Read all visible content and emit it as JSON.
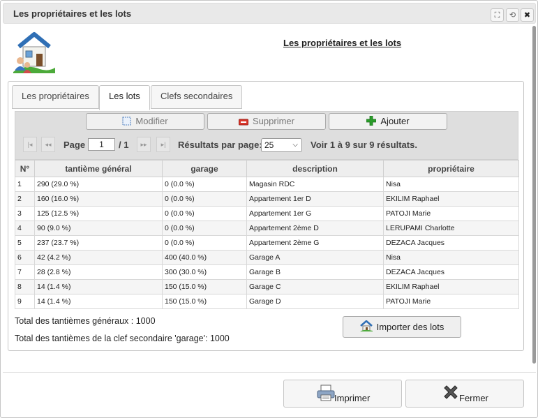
{
  "window": {
    "title": "Les propriétaires et les lots",
    "controls": {
      "maximize": "⛶",
      "restore": "⟲",
      "close": "✖"
    }
  },
  "heading": "Les propriétaires et les lots",
  "tabs": [
    {
      "label": "Les propriétaires",
      "active": false
    },
    {
      "label": "Les lots",
      "active": true
    },
    {
      "label": "Clefs secondaires",
      "active": false
    }
  ],
  "grid_buttons": {
    "modify": "Modifier",
    "delete": "Supprimer",
    "add": "Ajouter"
  },
  "pager": {
    "first": "|◂",
    "prev": "◂◂",
    "page_label": "Page",
    "page_value": "1",
    "page_total": "/ 1",
    "next": "▸▸",
    "last": "▸|",
    "results_label": "Résultats par page:",
    "results_value": "25",
    "summary": "Voir 1 à 9 sur 9 résultats."
  },
  "table": {
    "columns": [
      "N°",
      "tantième général",
      "garage",
      "description",
      "propriétaire"
    ],
    "rows": [
      [
        "1",
        "290 (29.0 %)",
        "0 (0.0 %)",
        "Magasin RDC",
        "Nisa"
      ],
      [
        "2",
        "160 (16.0 %)",
        "0 (0.0 %)",
        "Appartement 1er D",
        "EKILIM Raphael"
      ],
      [
        "3",
        "125 (12.5 %)",
        "0 (0.0 %)",
        "Appartement 1er G",
        "PATOJI Marie"
      ],
      [
        "4",
        "90 (9.0 %)",
        "0 (0.0 %)",
        "Appartement 2ème D",
        "LERUPAMI Charlotte"
      ],
      [
        "5",
        "237 (23.7 %)",
        "0 (0.0 %)",
        "Appartement 2ème G",
        "DEZACA Jacques"
      ],
      [
        "6",
        "42 (4.2 %)",
        "400 (40.0 %)",
        "Garage A",
        "Nisa"
      ],
      [
        "7",
        "28 (2.8 %)",
        "300 (30.0 %)",
        "Garage B",
        "DEZACA Jacques"
      ],
      [
        "8",
        "14 (1.4 %)",
        "150 (15.0 %)",
        "Garage C",
        "EKILIM Raphael"
      ],
      [
        "9",
        "14 (1.4 %)",
        "150 (15.0 %)",
        "Garage D",
        "PATOJI Marie"
      ]
    ]
  },
  "footer": {
    "total_general": "Total des tantièmes généraux : 1000",
    "total_garage": "Total des tantièmes de la clef secondaire 'garage': 1000",
    "import_button": "Importer des lots"
  },
  "bottom_buttons": {
    "print": "Imprimer",
    "close": "Fermer"
  },
  "colors": {
    "delete_icon": "#d9362b",
    "add_icon": "#2a9d2a"
  }
}
